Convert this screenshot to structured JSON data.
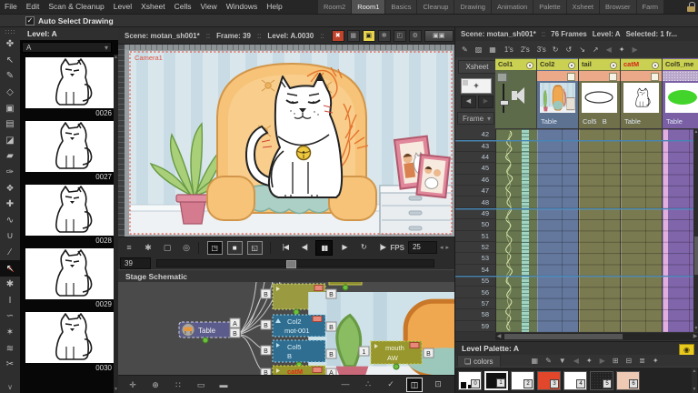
{
  "menubar": {
    "menus": [
      {
        "label": "File",
        "name": "menu-file"
      },
      {
        "label": "Edit",
        "name": "menu-edit"
      },
      {
        "label": "Scan & Cleanup",
        "name": "menu-scan-cleanup"
      },
      {
        "label": "Level",
        "name": "menu-level"
      },
      {
        "label": "Xsheet",
        "name": "menu-xsheet"
      },
      {
        "label": "Cells",
        "name": "menu-cells"
      },
      {
        "label": "View",
        "name": "menu-view"
      },
      {
        "label": "Windows",
        "name": "menu-windows"
      },
      {
        "label": "Help",
        "name": "menu-help"
      }
    ],
    "rooms": [
      {
        "label": "Room2",
        "name": "tab-room2"
      },
      {
        "label": "Room1",
        "name": "tab-room1",
        "cls": "active"
      },
      {
        "label": "Basics",
        "name": "tab-basics"
      },
      {
        "label": "Cleanup",
        "name": "tab-cleanup"
      },
      {
        "label": "Drawing",
        "name": "tab-drawing"
      },
      {
        "label": "Animation",
        "name": "tab-animation"
      },
      {
        "label": "Palette",
        "name": "tab-palette"
      },
      {
        "label": "Xsheet",
        "name": "tab-xsheet"
      },
      {
        "label": "Browser",
        "name": "tab-browser"
      },
      {
        "label": "Farm",
        "name": "tab-farm"
      }
    ]
  },
  "optionsbar": {
    "auto_select_label": "Auto Select Drawing",
    "check": "✓"
  },
  "tools": {
    "items": [
      {
        "name": "animate-tool-button",
        "icon": "animate-tool-icon",
        "glyph": "✤"
      },
      {
        "name": "selection-tool-button",
        "icon": "selection-tool-icon",
        "glyph": "↖"
      },
      {
        "name": "brush-tool-button",
        "icon": "brush-tool-icon",
        "glyph": "✎"
      },
      {
        "name": "geometric-tool-button",
        "icon": "geometric-tool-icon",
        "glyph": "◇"
      },
      {
        "name": "fill-tool-button",
        "icon": "fill-tool-icon",
        "glyph": "▣"
      },
      {
        "name": "palette-gizmo-button",
        "icon": "palette-gizmo-icon",
        "glyph": "▤"
      },
      {
        "name": "eraser-tool-button",
        "icon": "eraser-tool-icon",
        "glyph": "◪"
      },
      {
        "name": "tape-tool-button",
        "icon": "tape-tool-icon",
        "glyph": "▰"
      },
      {
        "name": "style-picker-button",
        "icon": "style-picker-icon",
        "glyph": "✑"
      },
      {
        "name": "rgb-picker-button",
        "icon": "rgb-picker-icon",
        "glyph": "❖"
      },
      {
        "name": "control-point-button",
        "icon": "control-point-icon",
        "glyph": "✚"
      },
      {
        "name": "pinch-tool-button",
        "icon": "pinch-tool-icon",
        "glyph": "∿"
      },
      {
        "name": "pump-tool-button",
        "icon": "pump-tool-icon",
        "glyph": "∪"
      },
      {
        "name": "ruler-tool-button",
        "icon": "ruler-tool-icon",
        "glyph": "∕"
      },
      {
        "name": "skeleton-tool-button",
        "icon": "skeleton-tool-icon",
        "glyph": "↖",
        "cls": "active"
      },
      {
        "name": "hand-tool-button",
        "icon": "hand-tool-icon",
        "glyph": "✱"
      },
      {
        "name": "type-tool-button",
        "icon": "type-tool-icon",
        "glyph": "I"
      },
      {
        "name": "hook-tool-button",
        "icon": "hook-tool-icon",
        "glyph": "∽"
      },
      {
        "name": "magnet-tool-button",
        "icon": "magnet-tool-icon",
        "glyph": "✶"
      },
      {
        "name": "iron-tool-button",
        "icon": "iron-tool-icon",
        "glyph": "≋"
      },
      {
        "name": "cutter-tool-button",
        "icon": "cutter-tool-icon",
        "glyph": "✂"
      }
    ],
    "collapse_glyph": "∨"
  },
  "flipbook": {
    "title": "Level:  A",
    "level_value": "A",
    "dropdown_glyph": "▾",
    "frames": [
      {
        "num": "0026"
      },
      {
        "num": "0027"
      },
      {
        "num": "0028"
      },
      {
        "num": "0029"
      },
      {
        "num": "0030"
      }
    ]
  },
  "viewer": {
    "title": {
      "scene": "Scene: motan_sh001*",
      "sep": "::",
      "frame": "Frame: 39",
      "level": "Level: A.0030"
    },
    "title_icons": [
      {
        "name": "preview-button",
        "icon": "preview-icon",
        "glyph": "✖",
        "cls": "red"
      },
      {
        "name": "table-view-button",
        "icon": "table-icon",
        "glyph": "▦"
      },
      {
        "name": "sub-camera-button",
        "icon": "sub-camera-icon",
        "glyph": "▣",
        "cls": "yellow"
      },
      {
        "name": "freeze-button",
        "icon": "freeze-icon",
        "glyph": "✻"
      },
      {
        "name": "3d-view-button",
        "icon": "cube-icon",
        "glyph": "◰"
      },
      {
        "name": "settings-button",
        "icon": "gear-icon",
        "glyph": "⚙"
      },
      {
        "name": "camera-select-button",
        "icon": "cameras-icon",
        "glyph": "▣▣",
        "cls": "wide"
      }
    ],
    "camera_label": "Camera1",
    "playback_left": [
      {
        "name": "viewer-menu-button",
        "icon": "hamburger-icon",
        "glyph": "≡"
      },
      {
        "name": "touch-gesture-button",
        "icon": "hand-icon",
        "glyph": "✱"
      },
      {
        "name": "camera-capture-button",
        "icon": "camera-icon",
        "glyph": "▢"
      },
      {
        "name": "snapshot-button",
        "icon": "snapshot-icon",
        "glyph": "◎"
      }
    ],
    "view_modes": [
      {
        "name": "camstand-view-button",
        "icon": "camstand-view-icon",
        "glyph": "◳",
        "cls": "pressed"
      },
      {
        "name": "3d-mode-button",
        "icon": "filled-square-icon",
        "glyph": "■"
      },
      {
        "name": "camera-view-button",
        "icon": "camera-view-icon",
        "glyph": "◱"
      }
    ],
    "transport": [
      {
        "name": "first-frame-button",
        "icon": "first-frame-icon",
        "glyph": "|◀"
      },
      {
        "name": "prev-frame-button",
        "icon": "prev-frame-icon",
        "glyph": "◀|"
      },
      {
        "name": "pause-button",
        "icon": "pause-icon",
        "glyph": "▮▮",
        "cls": "pressed"
      },
      {
        "name": "play-button",
        "icon": "play-icon",
        "glyph": "▶"
      },
      {
        "name": "loop-button",
        "icon": "loop-icon",
        "glyph": "↻"
      },
      {
        "name": "next-frame-button",
        "icon": "next-frame-icon",
        "glyph": "|▶"
      }
    ],
    "fps_label": "FPS",
    "fps_value": "25",
    "spin_left": "◂",
    "spin_right": "▸",
    "frame_field": "39"
  },
  "schematic": {
    "title": "Stage Schematic",
    "table_node": {
      "label": "Table",
      "port_a": "A",
      "port_b": "B"
    },
    "bg_node": {
      "port_in": "B",
      "port_out": "B"
    },
    "col2_node": {
      "line1": "Col2",
      "line2": "mot-001",
      "port_in": "B",
      "port_out": "B"
    },
    "col5_node": {
      "line1": "Col5",
      "line2": "B",
      "port_in": "B",
      "port_out": "B"
    },
    "catm_node": {
      "line1": "catM",
      "port_in": "B",
      "port_out": "A",
      "text_color": "#e02818"
    },
    "mouth_node": {
      "line1": "mouth",
      "line2": "AW",
      "port_in": "1",
      "port_out": "B"
    },
    "toolbar_left": [
      {
        "name": "fit-schematic-button",
        "icon": "fit-icon",
        "glyph": "✛"
      },
      {
        "name": "focus-node-button",
        "icon": "focus-icon",
        "glyph": "⊕"
      },
      {
        "name": "normalize-button",
        "icon": "grid-dots-icon",
        "glyph": "∷"
      },
      {
        "name": "minimized-nodes-button",
        "icon": "small-node-icon",
        "glyph": "▭"
      },
      {
        "name": "full-nodes-button",
        "icon": "large-node-icon",
        "glyph": "▬"
      }
    ],
    "toolbar_right": [
      {
        "name": "minimize-panel-button",
        "icon": "minimize-icon",
        "glyph": "—"
      },
      {
        "name": "stage-schematic-button",
        "icon": "nodes-icon",
        "glyph": "∴"
      },
      {
        "name": "spline-button",
        "icon": "checkmark-icon",
        "glyph": "✓"
      },
      {
        "name": "switch-schematic-button",
        "icon": "switch-view-icon",
        "glyph": "◫",
        "cls": "active"
      },
      {
        "name": "fx-schematic-button",
        "icon": "layers-icon",
        "glyph": "⊡"
      }
    ]
  },
  "xsheet": {
    "title": {
      "scene": "Scene: motan_sh001*",
      "sep": "::",
      "frames": "76 Frames",
      "level": "Level: A",
      "selected": "Selected: 1 fr..."
    },
    "toolbar": [
      {
        "name": "new-vector-level-button",
        "icon": "new-vector-level-icon",
        "glyph": "✎"
      },
      {
        "name": "new-toonz-raster-level-button",
        "icon": "new-toonz-raster-level-icon",
        "glyph": "▨"
      },
      {
        "name": "new-raster-level-button",
        "icon": "new-raster-level-icon",
        "glyph": "▦"
      },
      {
        "name": "step-1-button",
        "label": "1's"
      },
      {
        "name": "step-2-button",
        "label": "2's"
      },
      {
        "name": "step-3-button",
        "label": "3's"
      },
      {
        "name": "reframe-button",
        "icon": "reframe-icon",
        "glyph": "↻"
      },
      {
        "name": "repeat-button",
        "icon": "repeat-icon",
        "glyph": "↺"
      },
      {
        "name": "collapse-button",
        "icon": "collapse-icon",
        "glyph": "↘"
      },
      {
        "name": "open-subxsheet-button",
        "icon": "open-sub-icon",
        "glyph": "↗"
      },
      {
        "name": "prev-key-button",
        "icon": "prev-key-icon",
        "glyph": "◀",
        "cls": "dim"
      },
      {
        "name": "key-button",
        "icon": "key-icon",
        "glyph": "✦"
      },
      {
        "name": "next-key-button",
        "icon": "next-key-icon",
        "glyph": "▶",
        "cls": "dim"
      }
    ],
    "xsheet_button": "Xsheet",
    "add_frames_label": "+",
    "frame_dropdown": "Frame",
    "dropdown_glyph": "▾",
    "nav_left": "◀",
    "nav_right": "▶",
    "header_yellow": "#c9d052",
    "columns": [
      {
        "name": "Col1",
        "color": "#5d6b4b",
        "cell": "#67764e"
      },
      {
        "name": "Col2",
        "parent": "Table",
        "color": "#5d7191",
        "cell": "#64789e"
      },
      {
        "name": "tail",
        "parent": "Col5",
        "parent2": "B",
        "color": "#70704a",
        "cell": "#7a7a50"
      },
      {
        "name": "catM",
        "parent": "Table",
        "color": "#70704a",
        "cell": "#7a7a50",
        "name_color": "#d42414"
      },
      {
        "name": "Col5_me",
        "parent": "Table",
        "color": "#7a5fa5",
        "cell": "#8065ab",
        "strip": "#e2aee0"
      }
    ],
    "rows": [
      "42",
      "43",
      "44",
      "45",
      "46",
      "47",
      "48",
      "49",
      "50",
      "51",
      "52",
      "53",
      "54",
      "55",
      "56",
      "57",
      "58",
      "59"
    ],
    "marker_color": "#4585b5"
  },
  "palette": {
    "title": "Level Palette: A",
    "power_glyph": "◉",
    "tab": "colors",
    "tab_icon": "❏",
    "toolbar": [
      {
        "name": "styles-grid-button",
        "icon": "grid-icon",
        "glyph": "▦"
      },
      {
        "name": "style-name-editor-button",
        "icon": "edit-icon",
        "glyph": "✎"
      },
      {
        "name": "save-palette-button",
        "icon": "save-icon",
        "glyph": "▼"
      },
      {
        "name": "prev-key-button",
        "icon": "prev-key-icon",
        "glyph": "◀",
        "cls": "dim"
      },
      {
        "name": "key-button",
        "icon": "key-icon",
        "glyph": "✦"
      },
      {
        "name": "next-key-button",
        "icon": "next-key-icon",
        "glyph": "▶",
        "cls": "dim"
      },
      {
        "name": "new-page-button",
        "icon": "new-page-icon",
        "glyph": "⊞"
      },
      {
        "name": "delete-page-button",
        "icon": "delete-page-icon",
        "glyph": "⊟"
      },
      {
        "name": "palette-menu-button",
        "icon": "menu-icon",
        "glyph": "≣"
      },
      {
        "name": "lock-palette-button",
        "icon": "lock-icon",
        "glyph": "✦"
      }
    ],
    "swatches": [
      {
        "n": "0",
        "color": "#ffffff",
        "cls": "sw-ink"
      },
      {
        "n": "1",
        "color": "#111111",
        "cls": "sw-selected"
      },
      {
        "n": "2",
        "color": "#ffffff"
      },
      {
        "n": "3",
        "color": "#e2472b"
      },
      {
        "n": "4",
        "color": "#ffffff"
      },
      {
        "n": "5",
        "color": "#232323",
        "cls": "sw-tex"
      },
      {
        "n": "6",
        "color": "#eec9b4"
      }
    ]
  },
  "icons": {
    "up": "▲",
    "down": "▼",
    "left": "◀",
    "right": "▶"
  }
}
